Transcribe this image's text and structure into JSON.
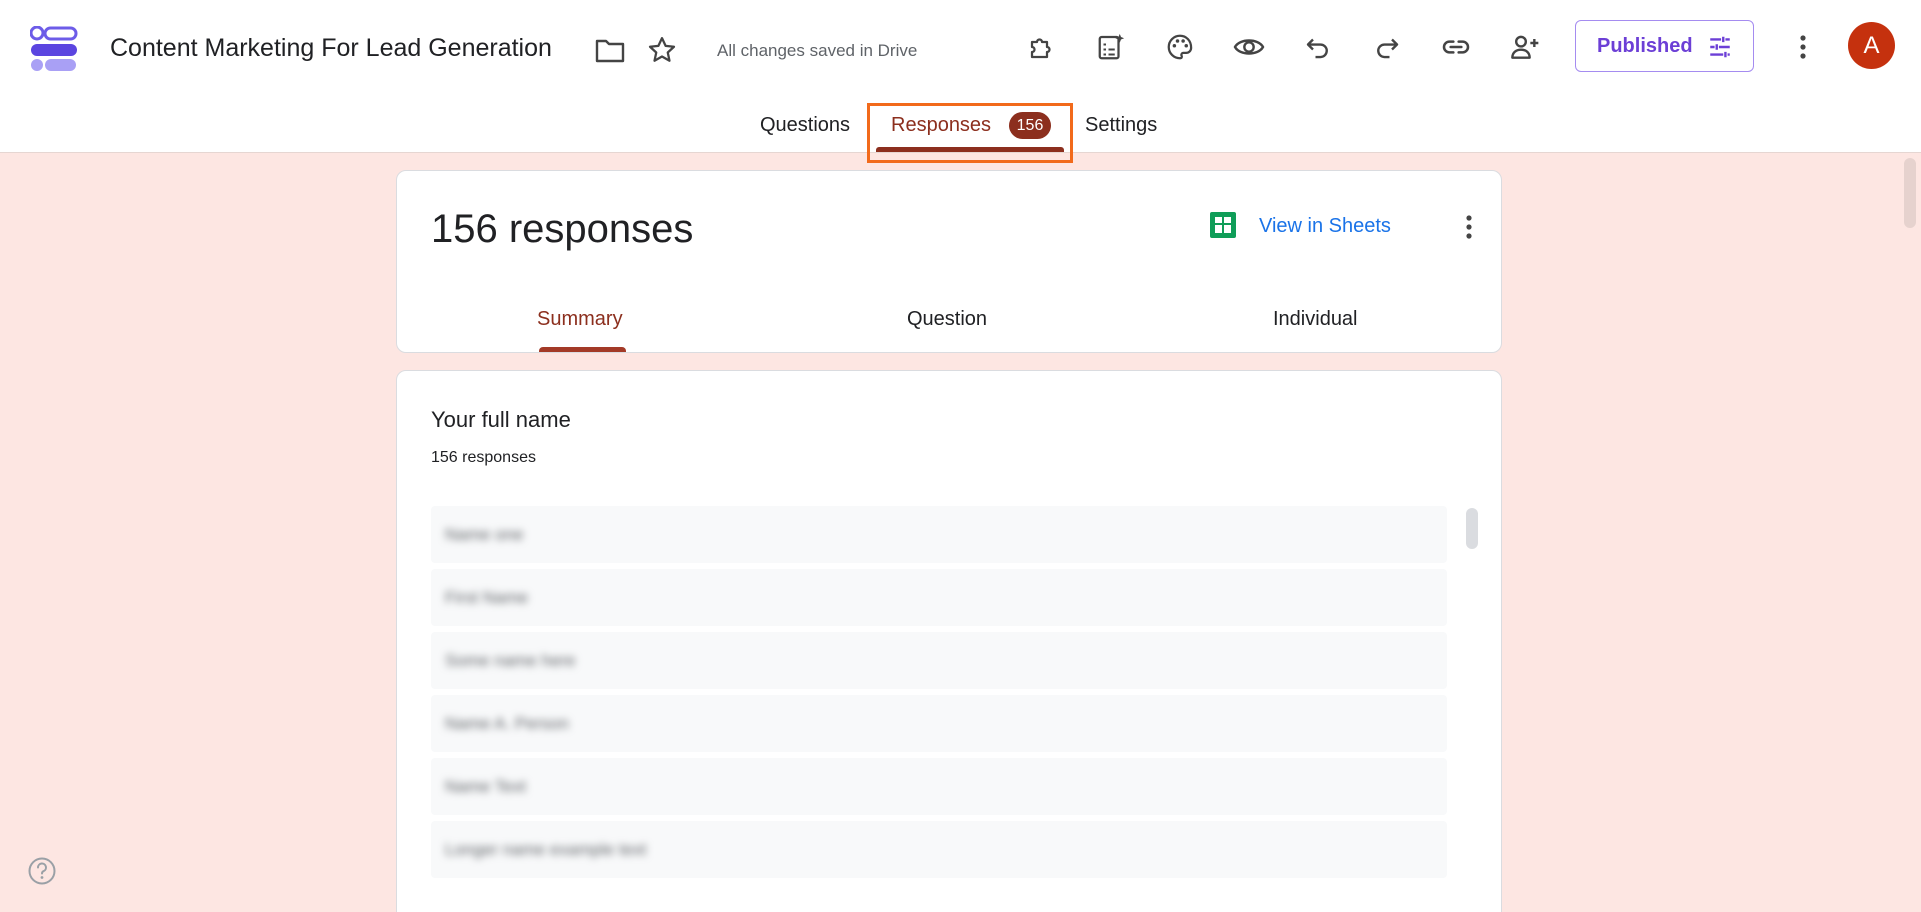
{
  "header": {
    "title": "Content Marketing For Lead Generation",
    "save_status": "All changes saved in Drive",
    "publish_label": "Published",
    "avatar_letter": "A",
    "icons": [
      "folder-icon",
      "star-icon",
      "addons-icon",
      "ai-summary-icon",
      "palette-icon",
      "preview-icon",
      "undo-icon",
      "redo-icon",
      "link-icon",
      "add-collaborator-icon",
      "tune-icon",
      "more-vert-icon"
    ]
  },
  "tabs": {
    "questions": "Questions",
    "responses": "Responses",
    "responses_badge": "156",
    "settings": "Settings",
    "active": "responses"
  },
  "summary": {
    "count_text": "156 responses",
    "view_in_sheets": "View in Sheets",
    "sub_tabs": {
      "summary": "Summary",
      "question": "Question",
      "individual": "Individual"
    },
    "active_sub_tab": "summary"
  },
  "question_card": {
    "title": "Your full name",
    "count_text": "156 responses",
    "responses": [
      "Name one",
      "First Name",
      "Some name here",
      "Name A. Person",
      "Name Text",
      "Longer name example text"
    ]
  },
  "colors": {
    "accent": "#8c2f1e",
    "background": "#fde6e2",
    "publish": "#6c3fd6",
    "link": "#1a73e8",
    "highlight": "#f26a1b",
    "avatar": "#c5310e",
    "sheets": "#0f9d58"
  }
}
